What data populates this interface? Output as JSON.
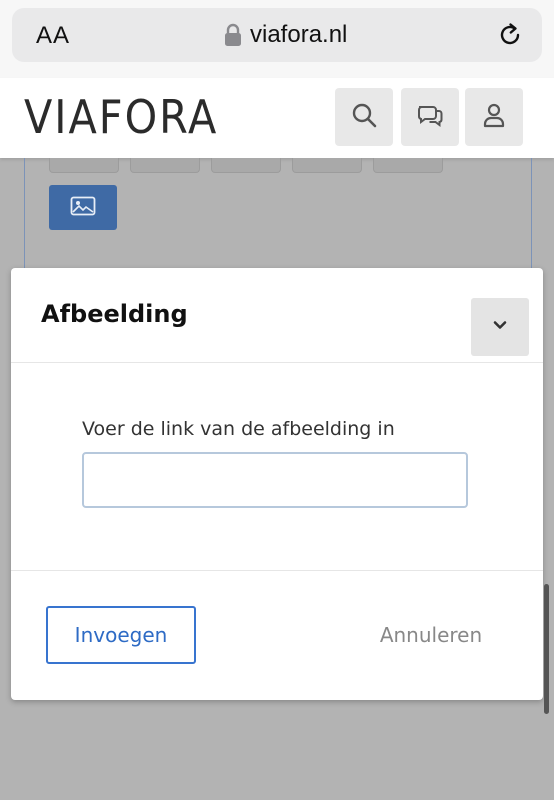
{
  "browser": {
    "text_size_label": "AA",
    "url": "viafora.nl",
    "icons": [
      "lock-icon",
      "reload-icon"
    ]
  },
  "site": {
    "logo": "VIAFORA",
    "header_icons": [
      "search-icon",
      "chat-icon",
      "user-icon"
    ]
  },
  "editor": {
    "image_tool_icon": "image-icon"
  },
  "dialog": {
    "title": "Afbeelding",
    "collapse_icon": "chevron-down-icon",
    "field_label": "Voer de link van de afbeelding in",
    "field_value": "",
    "insert_label": "Invoegen",
    "cancel_label": "Annuleren"
  },
  "colors": {
    "primary": "#3874cf",
    "image_button": "#3f6aa5",
    "overlay": "#b3b3b3"
  }
}
